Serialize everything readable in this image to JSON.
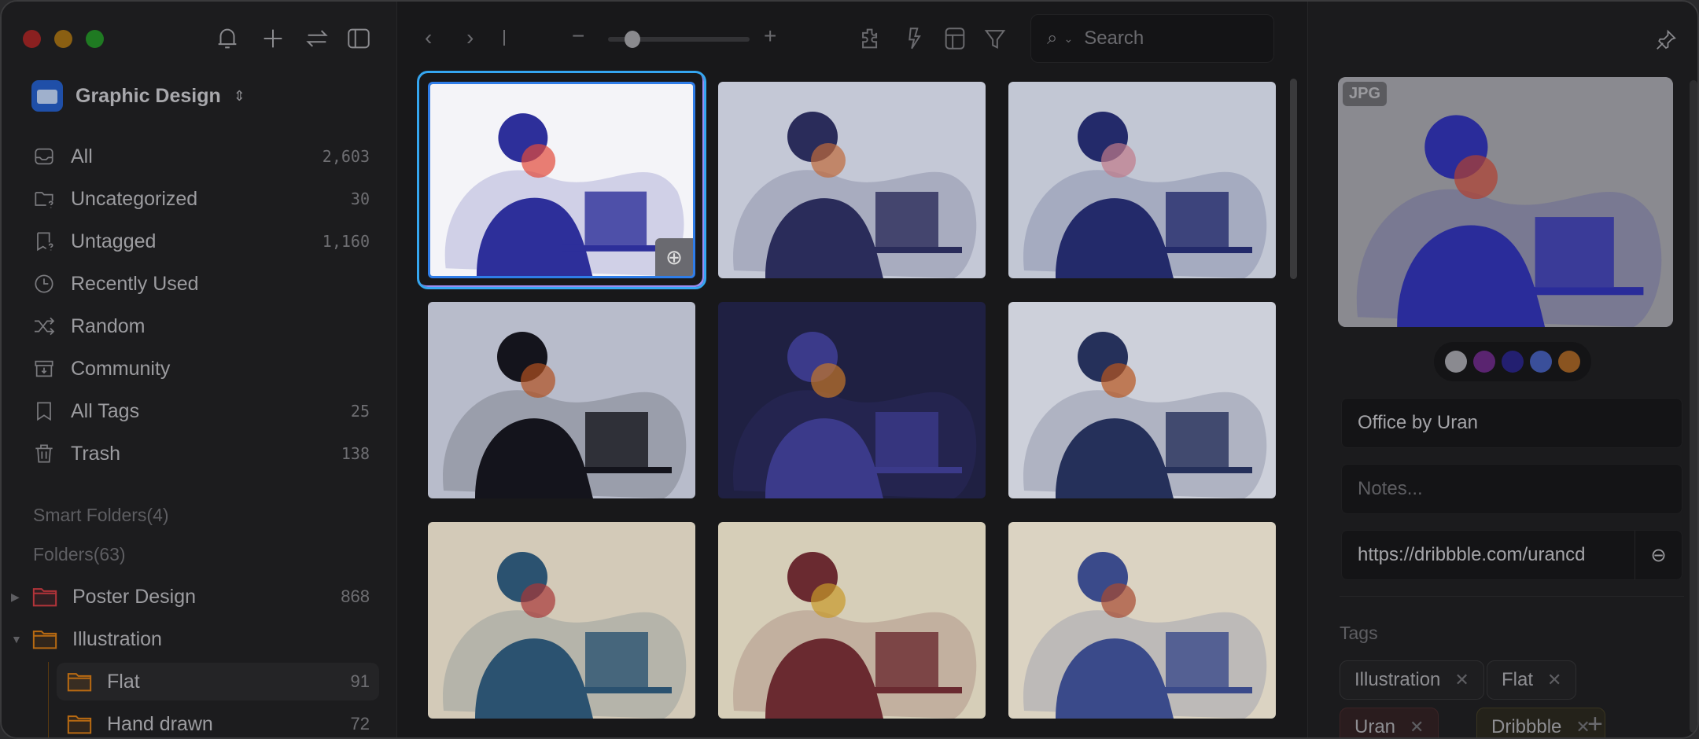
{
  "window": {
    "traffic_lights": [
      "#8a2020",
      "#8a5f12",
      "#1f7a22"
    ]
  },
  "sidebar": {
    "toolbar_icons": [
      "bell-icon",
      "plus-icon",
      "swap-icon",
      "sidebar-toggle-icon"
    ],
    "library": {
      "name": "Graphic Design",
      "chevron": "⌃⌄"
    },
    "items": [
      {
        "label": "All",
        "count": "2,603",
        "icon": "inbox-icon"
      },
      {
        "label": "Uncategorized",
        "count": "30",
        "icon": "folder-question-icon"
      },
      {
        "label": "Untagged",
        "count": "1,160",
        "icon": "tag-question-icon"
      },
      {
        "label": "Recently Used",
        "count": "",
        "icon": "clock-icon"
      },
      {
        "label": "Random",
        "count": "",
        "icon": "shuffle-icon"
      },
      {
        "label": "Community",
        "count": "",
        "icon": "archive-icon"
      },
      {
        "label": "All Tags",
        "count": "25",
        "icon": "bookmark-icon"
      },
      {
        "label": "Trash",
        "count": "138",
        "icon": "trash-icon"
      }
    ],
    "smart_folders": "Smart Folders(4)",
    "folders_header": "Folders(63)",
    "folders": [
      {
        "label": "Poster Design",
        "count": "868",
        "color": "#b3343a",
        "expanded": false
      },
      {
        "label": "Illustration",
        "count": "",
        "color": "#b86a12",
        "expanded": true
      },
      {
        "label": "Flat",
        "count": "91",
        "color": "#b86a12",
        "selected": true
      },
      {
        "label": "Hand drawn",
        "count": "72",
        "color": "#b86a12"
      }
    ]
  },
  "toolbar": {
    "search_placeholder": "Search",
    "zoom_level": 0.15
  },
  "grid": {
    "thumbnails": [
      {
        "bg": "#f4f4f8",
        "fg": "#2d2f9a",
        "accent": "#e24a3a",
        "selected": true
      },
      {
        "bg": "#c4c8d6",
        "fg": "#2a2c5a",
        "accent": "#c06a3a"
      },
      {
        "bg": "#c2c7d4",
        "fg": "#232a6a",
        "accent": "#c07a8a"
      },
      {
        "bg": "#b8bccb",
        "fg": "#14141c",
        "accent": "#b05020"
      },
      {
        "bg": "#1f2042",
        "fg": "#3b3a8a",
        "accent": "#c4762a"
      },
      {
        "bg": "#cdd0da",
        "fg": "#25305a",
        "accent": "#b8561e"
      },
      {
        "bg": "#d3cab8",
        "fg": "#2b5270",
        "accent": "#a83838"
      },
      {
        "bg": "#d6ceb8",
        "fg": "#6a2a30",
        "accent": "#c89a2a"
      },
      {
        "bg": "#dbd3c2",
        "fg": "#3a4a8a",
        "accent": "#a84a30"
      }
    ]
  },
  "inspector": {
    "format_badge": "JPG",
    "palette": [
      "#8a8a90",
      "#5a2470",
      "#231f70",
      "#3a4f9a",
      "#8a5420"
    ],
    "name": "Office by Uran",
    "notes_placeholder": "Notes...",
    "url": "https://dribbble.com/urancd",
    "tags_label": "Tags",
    "tags": [
      {
        "label": "Illustration",
        "bg": "#1e1e20",
        "border": "#2e2e30"
      },
      {
        "label": "Flat",
        "bg": "#1e1e20",
        "border": "#2e2e30"
      },
      {
        "label": "Uran",
        "bg": "#2a1c1e",
        "border": "#3c2426"
      },
      {
        "label": "Dribbble",
        "bg": "#24221a",
        "border": "#3a3520"
      }
    ],
    "add_tag": "+"
  }
}
